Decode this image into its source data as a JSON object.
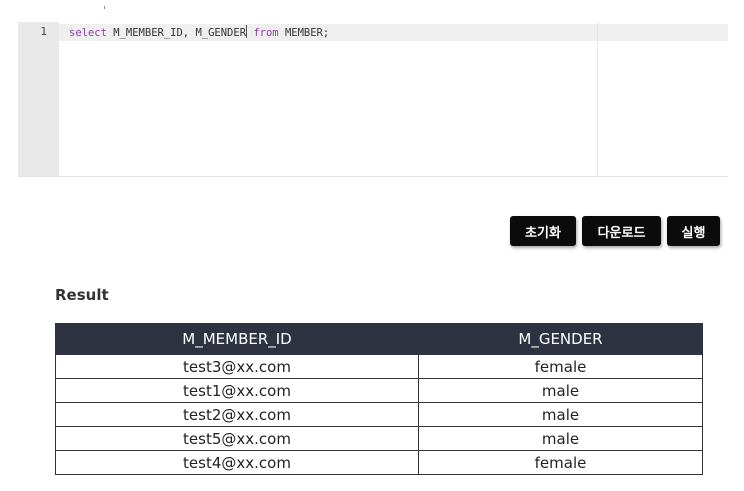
{
  "editor": {
    "line_number": "1",
    "tokens": [
      {
        "text": "select",
        "kind": "keyword"
      },
      {
        "text": " M_MEMBER_ID, M_GENDER",
        "kind": "plain"
      },
      {
        "text": " from",
        "kind": "keyword"
      },
      {
        "text": " MEMBER;",
        "kind": "plain"
      }
    ]
  },
  "toolbar": {
    "reset_label": "초기화",
    "download_label": "다운로드",
    "run_label": "실행"
  },
  "result": {
    "title": "Result",
    "columns": [
      "M_MEMBER_ID",
      "M_GENDER"
    ],
    "rows": [
      [
        "test3@xx.com",
        "female"
      ],
      [
        "test1@xx.com",
        "male"
      ],
      [
        "test2@xx.com",
        "male"
      ],
      [
        "test5@xx.com",
        "male"
      ],
      [
        "test4@xx.com",
        "female"
      ]
    ]
  },
  "colors": {
    "header_bg": "#2f3241",
    "button_bg": "#0b0b0b",
    "keyword": "#8c3ea3"
  }
}
